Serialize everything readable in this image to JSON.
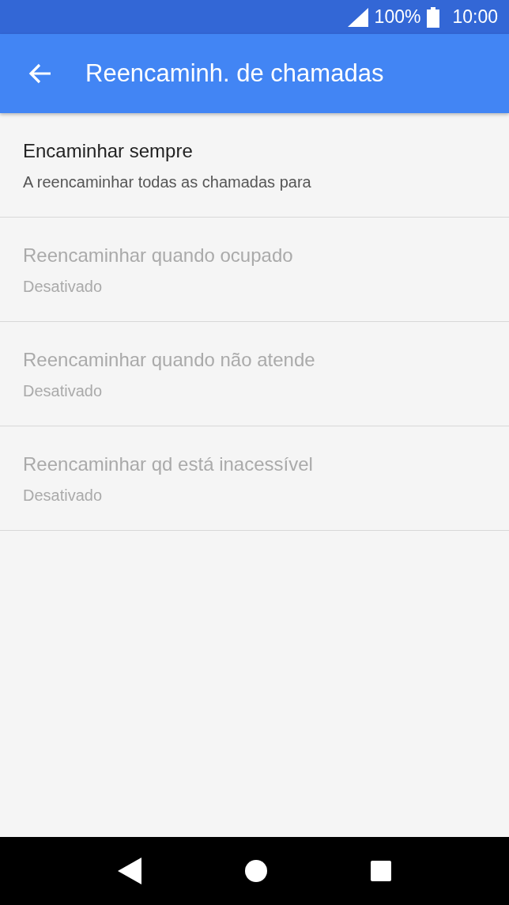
{
  "status_bar": {
    "battery": "100%",
    "time": "10:00"
  },
  "app_bar": {
    "title": "Reencaminh. de chamadas"
  },
  "items": [
    {
      "title": "Encaminhar sempre",
      "summary": "A reencaminhar todas as chamadas para",
      "disabled": false
    },
    {
      "title": "Reencaminhar quando ocupado",
      "summary": "Desativado",
      "disabled": true
    },
    {
      "title": "Reencaminhar quando não atende",
      "summary": "Desativado",
      "disabled": true
    },
    {
      "title": "Reencaminhar qd está inacessível",
      "summary": "Desativado",
      "disabled": true
    }
  ]
}
